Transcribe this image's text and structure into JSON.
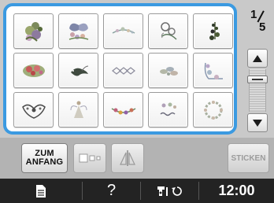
{
  "pattern_grid": {
    "page_current": "1",
    "page_total": "5",
    "cells": [
      {
        "icon": "bear-with-flowers-icon"
      },
      {
        "icon": "butterfly-flowers-icon"
      },
      {
        "icon": "floral-spray-icon"
      },
      {
        "icon": "rose-sprig-icon"
      },
      {
        "icon": "berry-branch-icon"
      },
      {
        "icon": "red-flower-garland-icon"
      },
      {
        "icon": "bird-icon"
      },
      {
        "icon": "diamond-border-icon"
      },
      {
        "icon": "leaf-cluster-icon"
      },
      {
        "icon": "corner-bouquet-icon"
      },
      {
        "icon": "lace-ornament-icon"
      },
      {
        "icon": "fairy-figure-icon"
      },
      {
        "icon": "flower-swag-icon"
      },
      {
        "icon": "spring-lettering-icon"
      },
      {
        "icon": "floral-wreath-icon"
      }
    ]
  },
  "actions": {
    "zum_anfang_line1": "ZUM",
    "zum_anfang_line2": "ANFANG",
    "sticken": "STICKEN"
  },
  "status": {
    "help": "?",
    "clock": "12:00"
  },
  "colors": {
    "selection_frame": "#3b9ae1",
    "status_bar": "#232323"
  }
}
